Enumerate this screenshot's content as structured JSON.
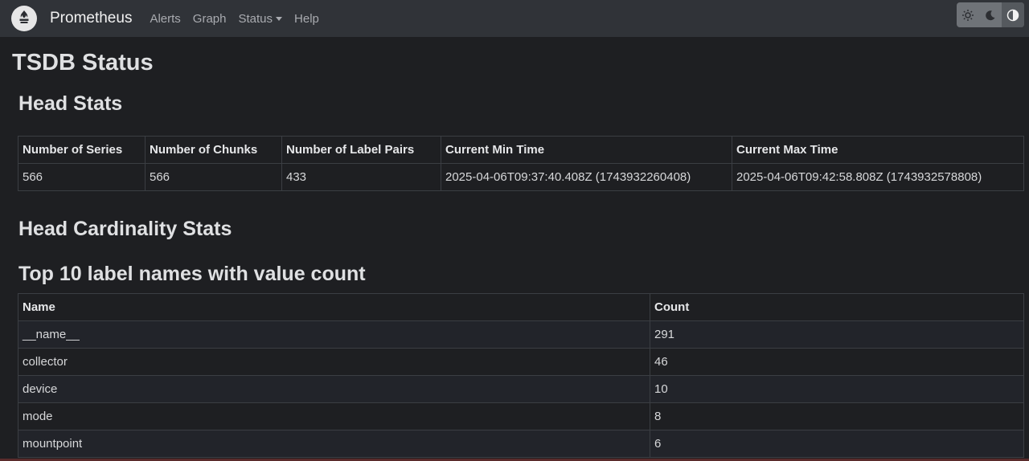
{
  "navbar": {
    "brand": "Prometheus",
    "links": [
      "Alerts",
      "Graph",
      "Status",
      "Help"
    ],
    "theme_icons": [
      "sun-icon",
      "moon-icon",
      "half-circle-icon"
    ]
  },
  "page": {
    "title": "TSDB Status"
  },
  "head_stats": {
    "heading": "Head Stats",
    "columns": [
      "Number of Series",
      "Number of Chunks",
      "Number of Label Pairs",
      "Current Min Time",
      "Current Max Time"
    ],
    "row": [
      "566",
      "566",
      "433",
      "2025-04-06T09:37:40.408Z (1743932260408)",
      "2025-04-06T09:42:58.808Z (1743932578808)"
    ]
  },
  "cardinality": {
    "heading": "Head Cardinality Stats",
    "sub_heading": "Top 10 label names with value count",
    "columns": [
      "Name",
      "Count"
    ],
    "rows": [
      [
        "__name__",
        "291"
      ],
      [
        "collector",
        "46"
      ],
      [
        "device",
        "10"
      ],
      [
        "mode",
        "8"
      ],
      [
        "mountpoint",
        "6"
      ]
    ]
  },
  "colors": {
    "background": "#1e1f22",
    "navbar": "#303338"
  }
}
